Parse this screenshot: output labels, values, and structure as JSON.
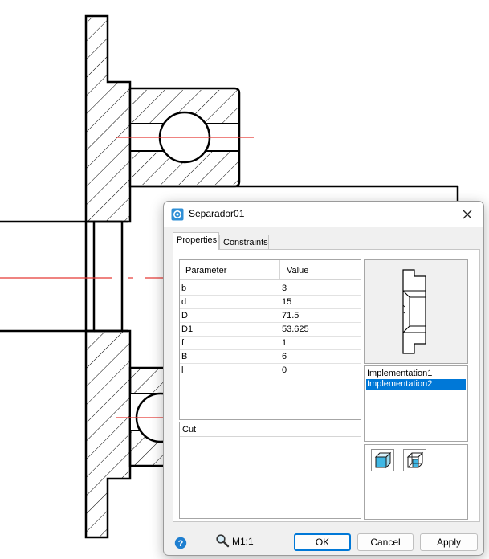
{
  "dialog": {
    "title": "Separador01",
    "tabs": [
      {
        "label": "Properties",
        "active": true
      },
      {
        "label": "Constraints",
        "active": false
      }
    ],
    "params_table": {
      "columns": [
        "Parameter",
        "Value"
      ],
      "rows": [
        {
          "name": "b",
          "value": "3"
        },
        {
          "name": "d",
          "value": "15"
        },
        {
          "name": "D",
          "value": "71.5"
        },
        {
          "name": "D1",
          "value": "53.625"
        },
        {
          "name": "f",
          "value": "1"
        },
        {
          "name": "B",
          "value": "6"
        },
        {
          "name": "l",
          "value": "0"
        }
      ]
    },
    "cut_label": "Cut",
    "implementations": [
      {
        "label": "Implementation1",
        "selected": false
      },
      {
        "label": "Implementation2",
        "selected": true
      }
    ],
    "scale_label": "M1:1",
    "buttons": {
      "ok": "OK",
      "cancel": "Cancel",
      "apply": "Apply"
    }
  },
  "icons": {
    "app": "part-icon",
    "close": "close-icon",
    "help": "help-icon",
    "zoom": "magnifier-icon",
    "view1": "solid-cube-icon",
    "view2": "section-cube-icon"
  },
  "colors": {
    "selection": "#0078d7",
    "center_line": "#e53935",
    "cube_fill": "#3fb7e4",
    "help": "#1f7fd0"
  }
}
